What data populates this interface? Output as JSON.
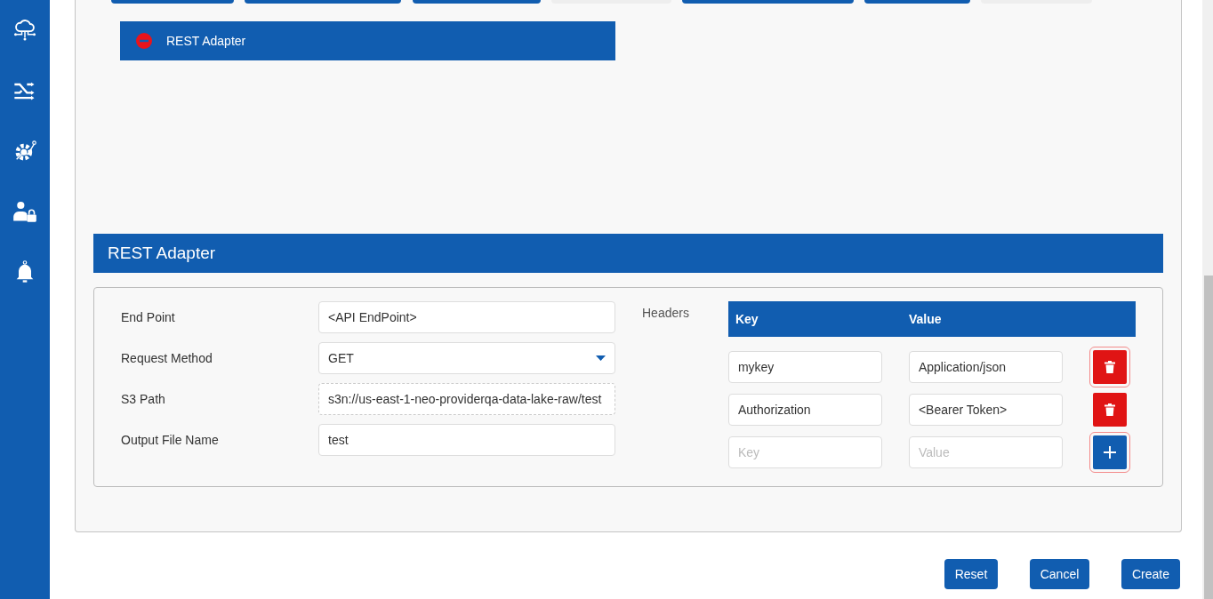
{
  "sidebar": {
    "items": [
      {
        "kind": "cloud"
      },
      {
        "kind": "shuffle"
      },
      {
        "kind": "gear"
      },
      {
        "kind": "user-lock"
      },
      {
        "kind": "bell"
      }
    ]
  },
  "top_tiles": [
    {
      "selected": true
    },
    {
      "selected": true
    },
    {
      "selected": true
    },
    {
      "selected": false
    },
    {
      "selected": true
    },
    {
      "selected": true
    },
    {
      "selected": false
    }
  ],
  "adapter_list": [
    {
      "label": "REST Adapter",
      "selected": true
    }
  ],
  "section": {
    "title": "REST Adapter"
  },
  "form": {
    "fields": [
      {
        "label": "End Point",
        "kind": "text",
        "value": "<API EndPoint>"
      },
      {
        "label": "Request Method",
        "kind": "select",
        "value": "GET"
      },
      {
        "label": "S3 Path",
        "kind": "readonly",
        "value": "s3n://us-east-1-neo-providerqa-data-lake-raw/test"
      },
      {
        "label": "Output File Name",
        "kind": "text",
        "value": "test"
      }
    ]
  },
  "headers": {
    "label": "Headers",
    "columns": [
      "Key",
      "Value"
    ],
    "rows": [
      {
        "key": "mykey",
        "value": "Application/json",
        "kind": "delete",
        "outlined": true
      },
      {
        "key": "Authorization",
        "value": "<Bearer Token>",
        "kind": "delete",
        "outlined": false
      },
      {
        "key_placeholder": "Key",
        "value_placeholder": "Value",
        "kind": "add",
        "outlined": true
      }
    ]
  },
  "buttons": [
    "Reset",
    "Cancel",
    "Create"
  ]
}
